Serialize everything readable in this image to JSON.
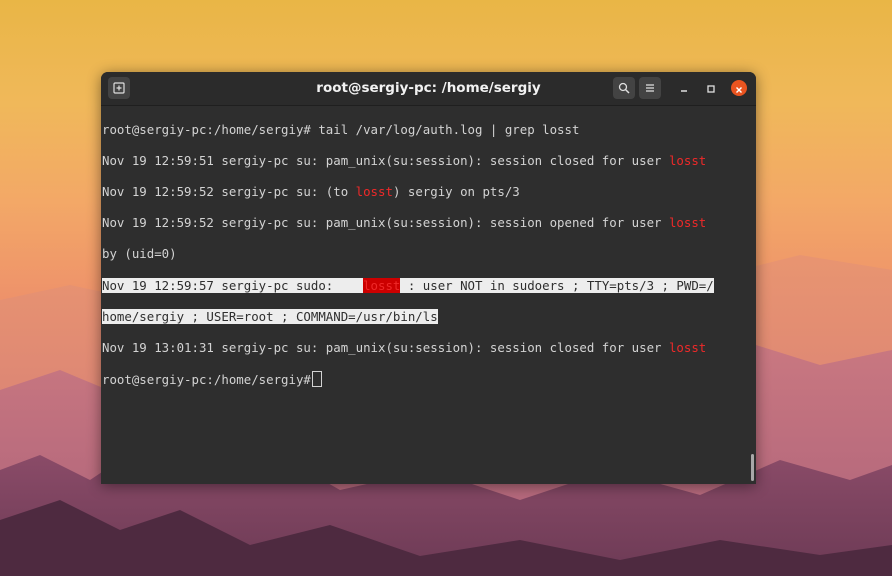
{
  "window": {
    "title": "root@sergiy-pc: /home/sergiy"
  },
  "toolbar": {
    "new_tab_icon": "new-tab-icon",
    "search_icon": "search-icon",
    "menu_icon": "hamburger-menu-icon",
    "minimize_icon": "minimize-icon",
    "maximize_icon": "maximize-icon",
    "close_icon": "close-icon"
  },
  "terminal": {
    "prompt": "root@sergiy-pc:/home/sergiy#",
    "command": " tail /var/log/auth.log | grep losst",
    "match": "losst",
    "lines": [
      {
        "before": "Nov 19 12:59:51 sergiy-pc su: pam_unix(su:session): session closed for user ",
        "after": ""
      },
      {
        "before": "Nov 19 12:59:52 sergiy-pc su: (to ",
        "after": ") sergiy on pts/3"
      },
      {
        "before": "Nov 19 12:59:52 sergiy-pc su: pam_unix(su:session): session opened for user ",
        "after": ""
      },
      {
        "before": "by (uid=0)",
        "after": ""
      },
      {
        "before": "Nov 19 12:59:57 sergiy-pc sudo:    ",
        "after": " : user NOT in sudoers ; TTY=pts/3 ; PWD=/"
      },
      {
        "before": "home/sergiy ; USER=root ; COMMAND=/usr/bin/ls",
        "after": ""
      },
      {
        "before": "Nov 19 13:01:31 sergiy-pc su: pam_unix(su:session): session closed for user ",
        "after": ""
      }
    ]
  },
  "colors": {
    "terminal_bg": "#2e2e2e",
    "text": "#d3d3d3",
    "match_red": "#ef2929",
    "close_orange": "#e95420",
    "selection_bg": "#ededed"
  }
}
